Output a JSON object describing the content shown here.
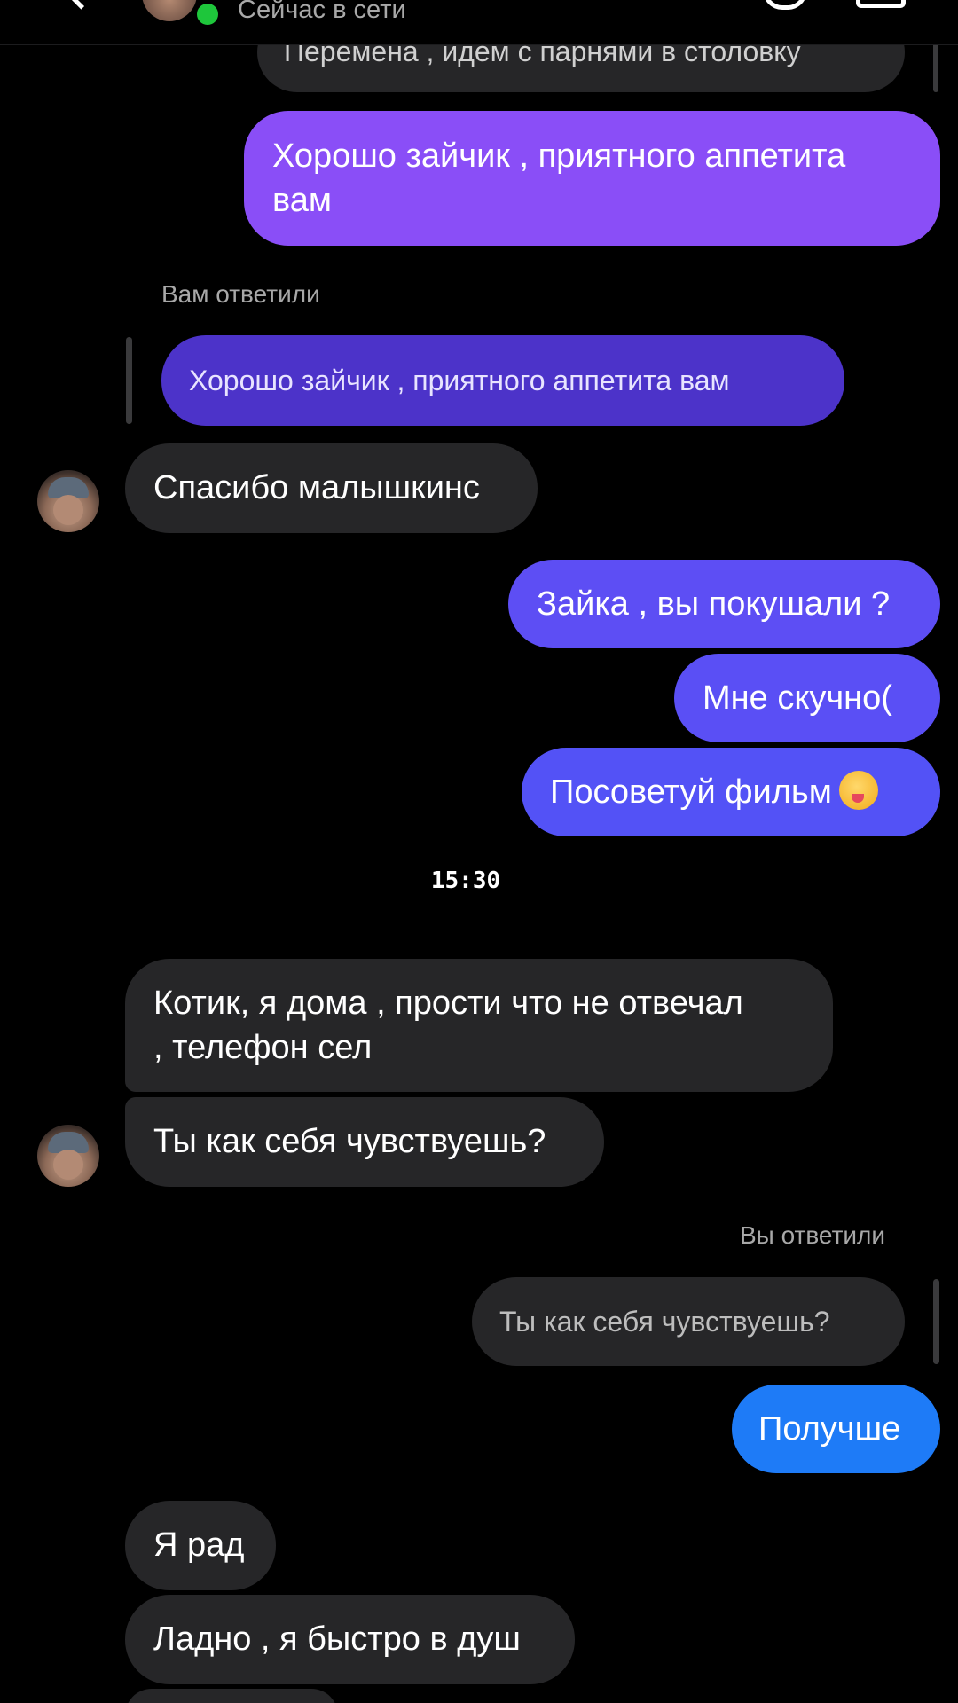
{
  "header": {
    "status": "Сейчас в сети"
  },
  "messages": {
    "m1": "Перемена , идем с парнями в столовку",
    "m2_line1": "Хорошо зайчик , приятного аппетита",
    "m2_line2": "вам",
    "reply_label_1": "Вам ответили",
    "quote_1": "Хорошо зайчик , приятного аппетита вам",
    "m3": "Спасибо малышкинс",
    "m4": "Зайка , вы покушали ?",
    "m5": "Мне скучно(",
    "m6": "Посоветуй фильм",
    "timestamp": "15:30",
    "m7_line1": "Котик, я дома , прости что не отвечал",
    "m7_line2": ", телефон сел",
    "m8": "Ты как себя чувствуешь?",
    "reply_label_2": "Вы ответили",
    "quote_2": "Ты как себя чувствуешь?",
    "m9": "Получше",
    "m10": "Я рад",
    "m11": "Ладно , я быстро в душ"
  },
  "colors": {
    "incoming_bubble": "#262628",
    "outgoing_top": "#8a4ef7",
    "outgoing_mid": "#5a4ff5",
    "outgoing_bottom": "#1e7bf7",
    "online_dot": "#1ec63b"
  },
  "icons": {
    "back": "chevron-left-icon",
    "call": "phone-icon",
    "video": "video-camera-icon",
    "emoji": "face-savoring-food-emoji"
  }
}
